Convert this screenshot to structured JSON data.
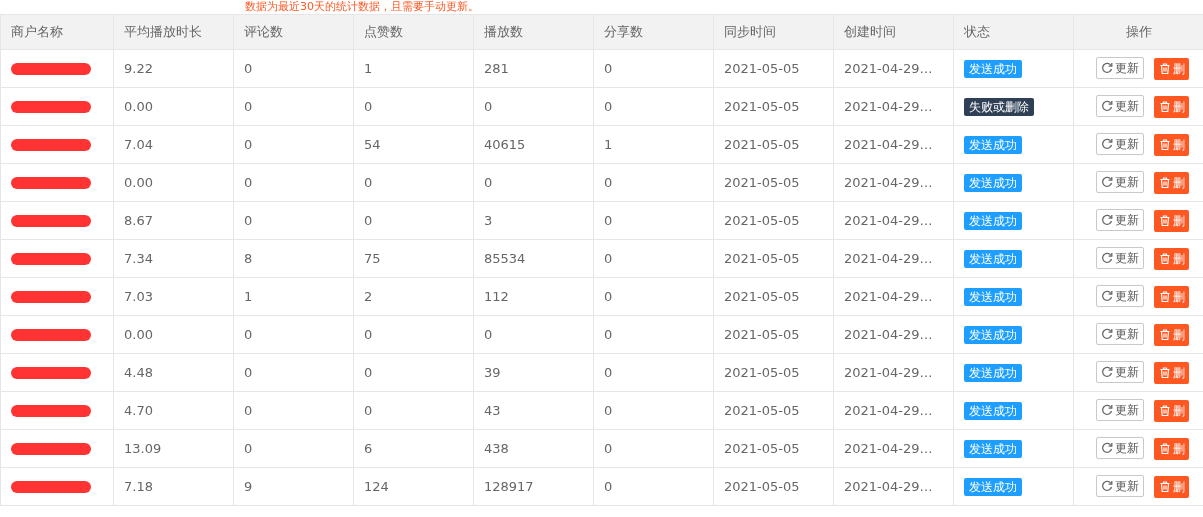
{
  "notice": "数据为最近30天的统计数据，且需要手动更新。",
  "table": {
    "columns": [
      "商户名称",
      "平均播放时长",
      "评论数",
      "点赞数",
      "播放数",
      "分享数",
      "同步时间",
      "创建时间",
      "状态",
      "操作"
    ],
    "rows": [
      {
        "avg": "9.22",
        "comments": "0",
        "likes": "1",
        "plays": "281",
        "shares": "0",
        "synced": "2021-05-05",
        "created": "2021-04-29…",
        "status": {
          "text": "发送成功",
          "kind": "success"
        },
        "update": "更新",
        "delete": "删"
      },
      {
        "avg": "0.00",
        "comments": "0",
        "likes": "0",
        "plays": "0",
        "shares": "0",
        "synced": "2021-05-05",
        "created": "2021-04-29…",
        "status": {
          "text": "失败或删除",
          "kind": "failed"
        },
        "update": "更新",
        "delete": "删"
      },
      {
        "avg": "7.04",
        "comments": "0",
        "likes": "54",
        "plays": "40615",
        "shares": "1",
        "synced": "2021-05-05",
        "created": "2021-04-29…",
        "status": {
          "text": "发送成功",
          "kind": "success"
        },
        "update": "更新",
        "delete": "删"
      },
      {
        "avg": "0.00",
        "comments": "0",
        "likes": "0",
        "plays": "0",
        "shares": "0",
        "synced": "2021-05-05",
        "created": "2021-04-29…",
        "status": {
          "text": "发送成功",
          "kind": "success"
        },
        "update": "更新",
        "delete": "删"
      },
      {
        "avg": "8.67",
        "comments": "0",
        "likes": "0",
        "plays": "3",
        "shares": "0",
        "synced": "2021-05-05",
        "created": "2021-04-29…",
        "status": {
          "text": "发送成功",
          "kind": "success"
        },
        "update": "更新",
        "delete": "删"
      },
      {
        "avg": "7.34",
        "comments": "8",
        "likes": "75",
        "plays": "85534",
        "shares": "0",
        "synced": "2021-05-05",
        "created": "2021-04-29…",
        "status": {
          "text": "发送成功",
          "kind": "success"
        },
        "update": "更新",
        "delete": "删"
      },
      {
        "avg": "7.03",
        "comments": "1",
        "likes": "2",
        "plays": "112",
        "shares": "0",
        "synced": "2021-05-05",
        "created": "2021-04-29…",
        "status": {
          "text": "发送成功",
          "kind": "success"
        },
        "update": "更新",
        "delete": "删"
      },
      {
        "avg": "0.00",
        "comments": "0",
        "likes": "0",
        "plays": "0",
        "shares": "0",
        "synced": "2021-05-05",
        "created": "2021-04-29…",
        "status": {
          "text": "发送成功",
          "kind": "success"
        },
        "update": "更新",
        "delete": "删"
      },
      {
        "avg": "4.48",
        "comments": "0",
        "likes": "0",
        "plays": "39",
        "shares": "0",
        "synced": "2021-05-05",
        "created": "2021-04-29…",
        "status": {
          "text": "发送成功",
          "kind": "success"
        },
        "update": "更新",
        "delete": "删"
      },
      {
        "avg": "4.70",
        "comments": "0",
        "likes": "0",
        "plays": "43",
        "shares": "0",
        "synced": "2021-05-05",
        "created": "2021-04-29…",
        "status": {
          "text": "发送成功",
          "kind": "success"
        },
        "update": "更新",
        "delete": "删"
      },
      {
        "avg": "13.09",
        "comments": "0",
        "likes": "6",
        "plays": "438",
        "shares": "0",
        "synced": "2021-05-05",
        "created": "2021-04-29…",
        "status": {
          "text": "发送成功",
          "kind": "success"
        },
        "update": "更新",
        "delete": "删"
      },
      {
        "avg": "7.18",
        "comments": "9",
        "likes": "124",
        "plays": "128917",
        "shares": "0",
        "synced": "2021-05-05",
        "created": "2021-04-29…",
        "status": {
          "text": "发送成功",
          "kind": "success"
        },
        "update": "更新",
        "delete": "删"
      }
    ]
  }
}
